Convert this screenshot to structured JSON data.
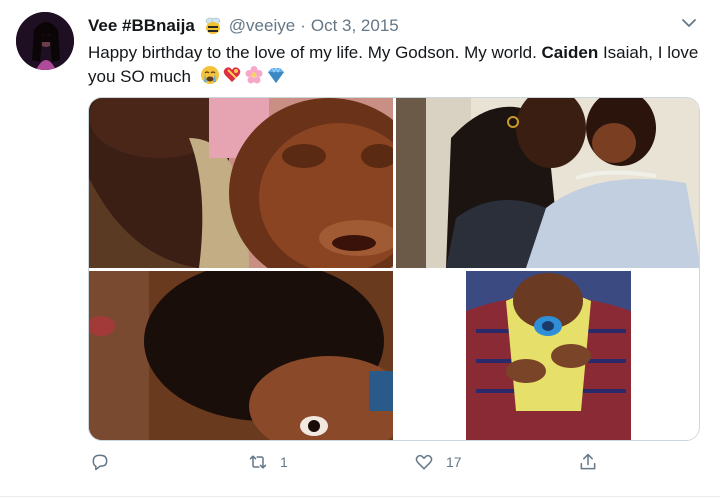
{
  "tweet": {
    "display_name": "Vee #BBnaija",
    "handle": "@veeiye",
    "separator": "·",
    "date": "Oct 3, 2015",
    "text_before": "Happy birthday to the love of my life. My Godson. My world. ",
    "text_bold": "Caiden",
    "text_after": " Isaiah, I love you SO much",
    "emojis": [
      "crying-face",
      "heart-with-ribbon",
      "cherry-blossom",
      "gem-stone"
    ]
  },
  "actions": {
    "reply_count": "",
    "retweet_count": "1",
    "like_count": "17"
  },
  "icons": {
    "reply": "reply-icon",
    "retweet": "retweet-icon",
    "like": "heart-icon",
    "share": "share-icon",
    "menu": "chevron-down-icon",
    "badge": "bee-icon"
  },
  "colors": {
    "text": "#14171a",
    "secondary": "#657786",
    "border": "#ccd6dd",
    "icon": "#657786"
  }
}
